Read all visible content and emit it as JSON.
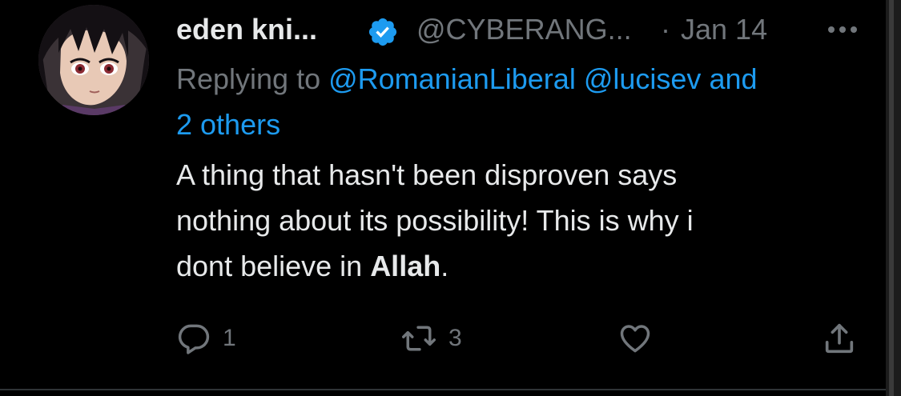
{
  "tweet": {
    "author": {
      "display_name": "eden kni...",
      "handle": "@CYBERANG...",
      "verified": true
    },
    "separator": "·",
    "date": "Jan 14",
    "reply_to": {
      "prefix": "Replying to ",
      "mention_1": "@RomanianLiberal",
      "mention_2": "@lucisev",
      "and_text": "and",
      "others": "2 others"
    },
    "text": {
      "line_1": "A thing that hasn't been disproven says",
      "line_2": "nothing about its possibility! This is why i",
      "line_3_start": "dont believe in ",
      "line_3_bold": "Allah",
      "line_3_end": "."
    },
    "actions": {
      "reply_count": "1",
      "retweet_count": "3"
    }
  },
  "colors": {
    "background": "#000000",
    "text": "#e7e9ea",
    "muted": "#71767b",
    "accent": "#1d9bf0"
  },
  "icons": {
    "verified": "verified-badge-icon",
    "more": "more-options-icon",
    "reply": "reply-bubble-icon",
    "retweet": "retweet-icon",
    "like": "heart-icon",
    "share": "share-icon"
  }
}
